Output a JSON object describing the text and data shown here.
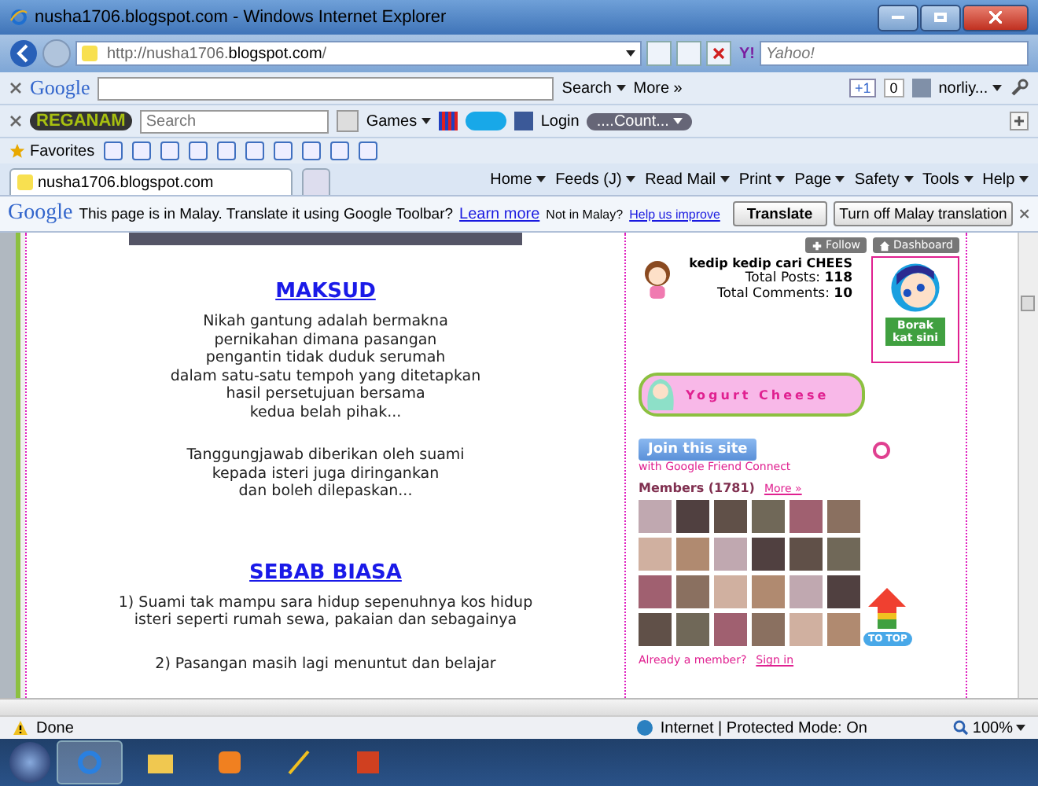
{
  "window": {
    "title": "nusha1706.blogspot.com - Windows Internet Explorer"
  },
  "address_bar": {
    "url_plain": "http://nusha1706.",
    "url_bold": "blogspot.com",
    "url_rest": "/",
    "search_logo": "Y!",
    "search_placeholder": "Yahoo!"
  },
  "google_toolbar": {
    "logo": "Google",
    "search_button": "Search",
    "more": "More »",
    "plus_one": "+1",
    "count": "0",
    "user": "norliy..."
  },
  "reganam_toolbar": {
    "logo": "REGANAM",
    "search_placeholder": "Search",
    "games": "Games",
    "login": "Login",
    "counter": "....Count..."
  },
  "favorites": {
    "label": "Favorites"
  },
  "tabs": [
    {
      "label": "nusha1706.blogspot.com",
      "selected": true
    }
  ],
  "commands": [
    "Home",
    "Feeds (J)",
    "Read Mail",
    "Print",
    "Page",
    "Safety",
    "Tools",
    "Help"
  ],
  "translate_bar": {
    "logo": "Google",
    "message": "This page is in Malay.  Translate it using Google Toolbar?",
    "learn_more": "Learn more",
    "not_in": "Not in Malay?",
    "help": "Help us improve",
    "translate": "Translate",
    "turn_off": "Turn off Malay translation"
  },
  "post": {
    "sections": [
      {
        "heading": "MAKSUD",
        "paragraphs": [
          [
            "Nikah gantung adalah bermakna",
            "pernikahan dimana pasangan",
            "pengantin tidak duduk serumah",
            "dalam satu-satu tempoh yang ditetapkan",
            "hasil persetujuan bersama",
            "kedua belah pihak..."
          ],
          [
            "Tanggungjawab diberikan oleh suami",
            "kepada isteri juga diringankan",
            "dan boleh dilepaskan..."
          ]
        ]
      },
      {
        "heading": "SEBAB BIASA",
        "paragraphs": [
          [
            "1) Suami tak mampu sara hidup sepenuhnya kos hidup",
            "isteri seperti rumah sewa, pakaian dan sebagainya"
          ],
          [
            "2) Pasangan masih lagi menuntut dan belajar"
          ]
        ]
      }
    ]
  },
  "sidebar": {
    "follow": "Follow",
    "dashboard": "Dashboard",
    "blog_name": "kedip kedip cari CHEES",
    "posts_label": "Total Posts:",
    "posts_value": "118",
    "comments_label": "Total Comments:",
    "comments_value": "10",
    "sticker": "Borak kat sini",
    "banner": "Yogurt Cheese",
    "join": "Join this site",
    "join_sub": "with Google Friend Connect",
    "members": "Members (1781)",
    "more": "More »",
    "already": "Already a member?",
    "sign_in": "Sign in",
    "to_top": "TO TOP"
  },
  "status_bar": {
    "status": "Done",
    "zone": "Internet | Protected Mode: On",
    "zoom": "100%"
  },
  "taskbar": [
    {
      "kind": "ie",
      "selected": true
    },
    {
      "kind": "folder",
      "selected": false
    },
    {
      "kind": "media",
      "selected": false
    },
    {
      "kind": "pen",
      "selected": false
    },
    {
      "kind": "slides",
      "selected": false
    }
  ]
}
